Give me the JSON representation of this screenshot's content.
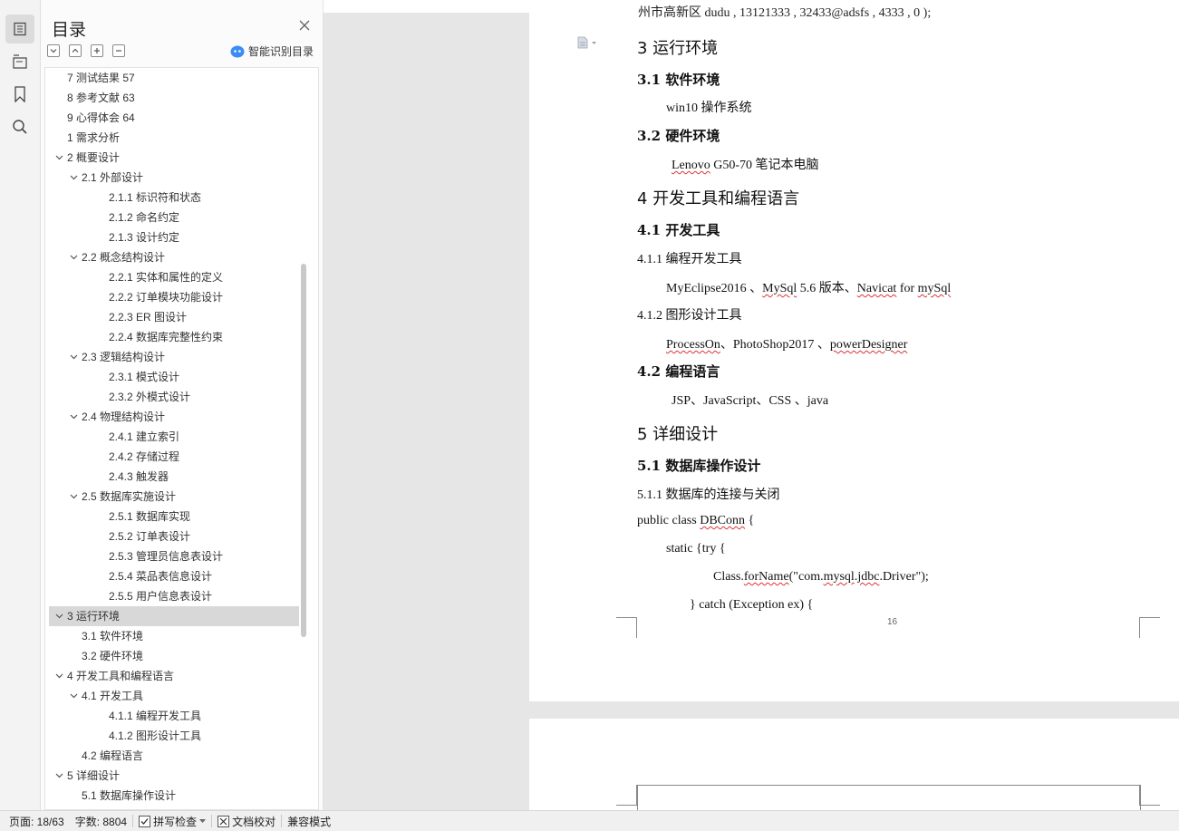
{
  "toc": {
    "title": "目录",
    "smart_label": "智能识别目录",
    "items": [
      {
        "label": "7 测试结果 57",
        "level": 1,
        "expander": "",
        "selected": false
      },
      {
        "label": "8 参考文献 63",
        "level": 1,
        "expander": "",
        "selected": false
      },
      {
        "label": "9 心得体会 64",
        "level": 1,
        "expander": "",
        "selected": false
      },
      {
        "label": "1 需求分析",
        "level": 1,
        "expander": "",
        "selected": false
      },
      {
        "label": "2 概要设计",
        "level": 1,
        "expander": "down",
        "selected": false
      },
      {
        "label": "2.1 外部设计",
        "level": 2,
        "expander": "down",
        "selected": false
      },
      {
        "label": "2.1.1 标识符和状态",
        "level": 3,
        "expander": "",
        "selected": false
      },
      {
        "label": "2.1.2 命名约定",
        "level": 3,
        "expander": "",
        "selected": false
      },
      {
        "label": "2.1.3 设计约定",
        "level": 3,
        "expander": "",
        "selected": false
      },
      {
        "label": "2.2 概念结构设计",
        "level": 2,
        "expander": "down",
        "selected": false
      },
      {
        "label": "2.2.1 实体和属性的定义",
        "level": 3,
        "expander": "",
        "selected": false
      },
      {
        "label": "2.2.2 订单模块功能设计",
        "level": 3,
        "expander": "",
        "selected": false
      },
      {
        "label": "2.2.3 ER 图设计",
        "level": 3,
        "expander": "",
        "selected": false
      },
      {
        "label": "2.2.4 数据库完整性约束",
        "level": 3,
        "expander": "",
        "selected": false
      },
      {
        "label": "2.3 逻辑结构设计",
        "level": 2,
        "expander": "down",
        "selected": false
      },
      {
        "label": "2.3.1 模式设计",
        "level": 3,
        "expander": "",
        "selected": false
      },
      {
        "label": "2.3.2 外模式设计",
        "level": 3,
        "expander": "",
        "selected": false
      },
      {
        "label": "2.4 物理结构设计",
        "level": 2,
        "expander": "down",
        "selected": false
      },
      {
        "label": "2.4.1 建立索引",
        "level": 3,
        "expander": "",
        "selected": false
      },
      {
        "label": "2.4.2 存储过程",
        "level": 3,
        "expander": "",
        "selected": false
      },
      {
        "label": "2.4.3 触发器",
        "level": 3,
        "expander": "",
        "selected": false
      },
      {
        "label": "2.5 数据库实施设计",
        "level": 2,
        "expander": "down",
        "selected": false
      },
      {
        "label": "2.5.1 数据库实现",
        "level": 3,
        "expander": "",
        "selected": false
      },
      {
        "label": "2.5.2 订单表设计",
        "level": 3,
        "expander": "",
        "selected": false
      },
      {
        "label": "2.5.3 管理员信息表设计",
        "level": 3,
        "expander": "",
        "selected": false
      },
      {
        "label": "2.5.4 菜品表信息设计",
        "level": 3,
        "expander": "",
        "selected": false
      },
      {
        "label": "2.5.5 用户信息表设计",
        "level": 3,
        "expander": "",
        "selected": false
      },
      {
        "label": "3 运行环境",
        "level": 1,
        "expander": "down",
        "selected": true
      },
      {
        "label": "3.1 软件环境",
        "level": 2,
        "expander": "",
        "selected": false
      },
      {
        "label": "3.2 硬件环境",
        "level": 2,
        "expander": "",
        "selected": false
      },
      {
        "label": "4 开发工具和编程语言",
        "level": 1,
        "expander": "down",
        "selected": false
      },
      {
        "label": "4.1 开发工具",
        "level": 2,
        "expander": "down",
        "selected": false
      },
      {
        "label": "4.1.1 编程开发工具",
        "level": 3,
        "expander": "",
        "selected": false
      },
      {
        "label": "4.1.2 图形设计工具",
        "level": 3,
        "expander": "",
        "selected": false
      },
      {
        "label": "4.2 编程语言",
        "level": 2,
        "expander": "",
        "selected": false
      },
      {
        "label": "5 详细设计",
        "level": 1,
        "expander": "down",
        "selected": false
      },
      {
        "label": "5.1 数据库操作设计",
        "level": 2,
        "expander": "",
        "selected": false
      }
    ]
  },
  "doc": {
    "cut_line": "州市高新区 dudu , 13121333 , 32433@adsfs , 4333 , 0 );",
    "lines": [
      {
        "kind": "h1",
        "text": "3 运行环境"
      },
      {
        "kind": "h2",
        "text": "3.1 软件环境"
      },
      {
        "kind": "body",
        "text": "win10 操作系统",
        "indent": 1
      },
      {
        "kind": "h2",
        "text": "3.2 硬件环境"
      },
      {
        "kind": "body",
        "text": "Lenovo G50-70 笔记本电脑",
        "indent": 1
      },
      {
        "kind": "h1",
        "text": "4 开发工具和编程语言"
      },
      {
        "kind": "h2",
        "text": "4.1 开发工具"
      },
      {
        "kind": "body",
        "text": "4.1.1 编程开发工具",
        "indent": 0
      },
      {
        "kind": "body",
        "text": "MyEclipse2016 、MySql 5.6 版本、Navicat for mySql",
        "indent": 1
      },
      {
        "kind": "body",
        "text": "4.1.2 图形设计工具",
        "indent": 0
      },
      {
        "kind": "body",
        "text": "ProcessOn、PhotoShop2017 、powerDesigner",
        "indent": 1
      },
      {
        "kind": "h2",
        "text": "4.2 编程语言"
      },
      {
        "kind": "body",
        "text": "JSP、JavaScript、CSS 、java",
        "indent": 1
      },
      {
        "kind": "h1",
        "text": "5 详细设计"
      },
      {
        "kind": "h2",
        "text": "5.1 数据库操作设计"
      },
      {
        "kind": "body",
        "text": "5.1.1 数据库的连接与关闭",
        "indent": 0
      },
      {
        "kind": "body",
        "text": "public class DBConn {",
        "indent": 0
      },
      {
        "kind": "body",
        "text": "static {try {",
        "indent": 1
      },
      {
        "kind": "body",
        "text": "Class.forName(\"com.mysql.jdbc.Driver\");",
        "indent": 3
      },
      {
        "kind": "body",
        "text": "} catch (Exception ex) {",
        "indent": 2
      }
    ],
    "page_number": "16"
  },
  "status": {
    "page": "页面: 18/63",
    "words": "字数: 8804",
    "spell": "拼写检查",
    "proof": "文档校对",
    "compat": "兼容模式"
  }
}
